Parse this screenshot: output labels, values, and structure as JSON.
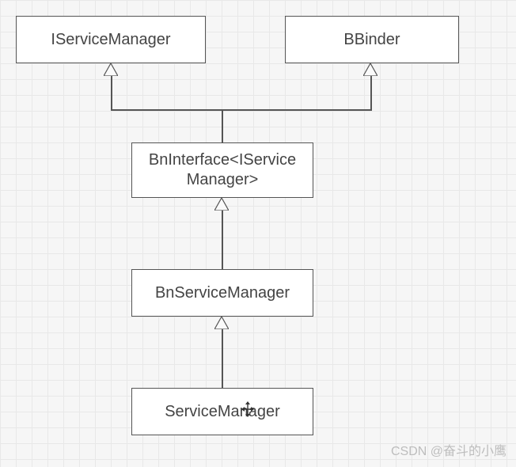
{
  "boxes": {
    "iservicemanager": "IServiceManager",
    "bbinder": "BBinder",
    "bninterface": "BnInterface<IService\nManager>",
    "bnservicemanager": "BnServiceManager",
    "servicemanager": "ServiceManager"
  },
  "watermark": "CSDN @奋斗的小鹰"
}
